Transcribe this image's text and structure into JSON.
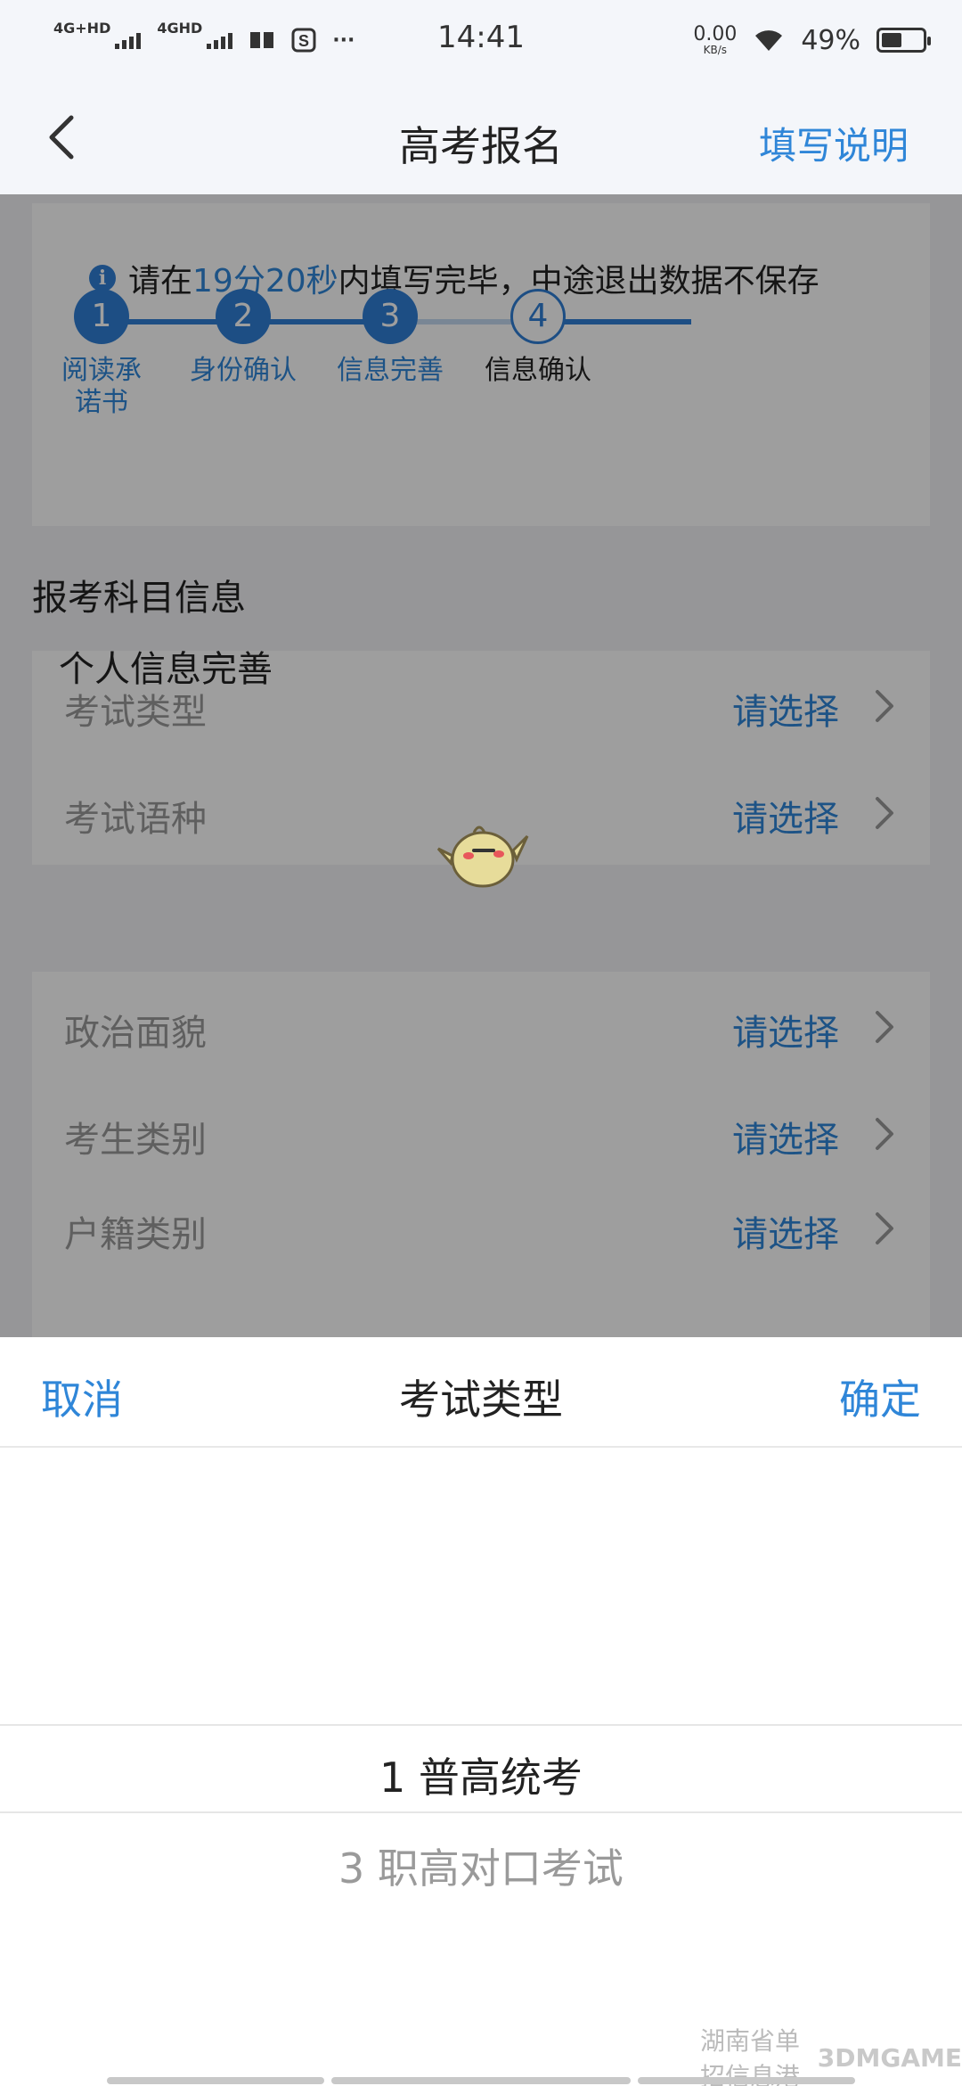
{
  "status_bar": {
    "signal_1": "4G+HD",
    "signal_2": "4GHD",
    "more": "···",
    "time": "14:41",
    "speed_value": "0.00",
    "speed_unit": "KB/s",
    "battery_text": "49%",
    "battery_level": 0.49
  },
  "nav": {
    "title": "高考报名",
    "help": "填写说明"
  },
  "notice": {
    "prefix": "请在",
    "countdown": "19分20秒",
    "suffix": "内填写完毕，中途退出数据不保存"
  },
  "steps": [
    {
      "num": "1",
      "label": "阅读承诺书",
      "state": "done"
    },
    {
      "num": "2",
      "label": "身份确认",
      "state": "done"
    },
    {
      "num": "3",
      "label": "信息完善",
      "state": "done"
    },
    {
      "num": "4",
      "label": "信息确认",
      "state": "todo"
    }
  ],
  "exam_section": {
    "title": "报考科目信息",
    "rows": [
      {
        "label": "考试类型",
        "value": "请选择"
      },
      {
        "label": "考试语种",
        "value": "请选择"
      }
    ]
  },
  "personal_section": {
    "title": "个人信息完善",
    "rows": [
      {
        "label": "政治面貌",
        "value": "请选择"
      },
      {
        "label": "考生类别",
        "value": "请选择"
      },
      {
        "label": "户籍类别",
        "value": "请选择"
      }
    ]
  },
  "picker": {
    "cancel": "取消",
    "title": "考试类型",
    "confirm": "确定",
    "options": [
      "1 普高统考",
      "3 职高对口考试"
    ],
    "selected_index": 0
  },
  "watermark": {
    "text": "湖南省单招信息港",
    "brand": "3DMGAME"
  },
  "colors": {
    "accent": "#2f86d8",
    "step_fill": "#2f7fd6"
  }
}
